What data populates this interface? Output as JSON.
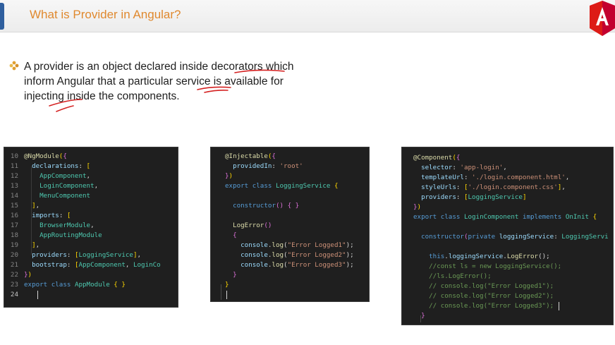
{
  "slide": {
    "title": "What is Provider in Angular?",
    "bullet": "A provider is an object declared inside decorators which\ninform Angular that a particular service is available for\ninjecting inside the components.",
    "ink_color": "#d42020",
    "accent_color": "#e0892f",
    "logo_color": "#dd1b16"
  },
  "module_code": {
    "lines": [
      {
        "no": "10",
        "text": "@NgModule({"
      },
      {
        "no": "11",
        "text": "  declarations: ["
      },
      {
        "no": "12",
        "text": "    AppComponent,"
      },
      {
        "no": "13",
        "text": "    LoginComponent,"
      },
      {
        "no": "14",
        "text": "    MenuComponent"
      },
      {
        "no": "15",
        "text": "  ],"
      },
      {
        "no": "16",
        "text": "  imports: ["
      },
      {
        "no": "17",
        "text": "    BrowserModule,"
      },
      {
        "no": "18",
        "text": "    AppRoutingModule"
      },
      {
        "no": "19",
        "text": "  ],"
      },
      {
        "no": "20",
        "text": "  providers: [LoggingService],"
      },
      {
        "no": "21",
        "text": "  bootstrap: [AppComponent, LoginCo"
      },
      {
        "no": "22",
        "text": "})"
      },
      {
        "no": "23",
        "text": "export class AppModule { }"
      },
      {
        "no": "24",
        "text": ""
      }
    ]
  },
  "service_code": {
    "lines": [
      {
        "text": "@Injectable({"
      },
      {
        "text": "  providedIn: 'root'"
      },
      {
        "text": "})"
      },
      {
        "text": "export class LoggingService {"
      },
      {
        "text": ""
      },
      {
        "text": "  constructor() { }"
      },
      {
        "text": ""
      },
      {
        "text": "  LogError()"
      },
      {
        "text": "  {"
      },
      {
        "text": "    console.log(\"Error Logged1\");"
      },
      {
        "text": "    console.log(\"Error Logged2\");"
      },
      {
        "text": "    console.log(\"Error Logged3\");"
      },
      {
        "text": "  }"
      },
      {
        "text": "}"
      }
    ]
  },
  "component_code": {
    "lines": [
      {
        "text": "@Component({"
      },
      {
        "text": "  selector: 'app-login',"
      },
      {
        "text": "  templateUrl: './login.component.html',"
      },
      {
        "text": "  styleUrls: ['./login.component.css'],"
      },
      {
        "text": "  providers: [LoggingService]"
      },
      {
        "text": "})"
      },
      {
        "text": "export class LoginComponent implements OnInit {"
      },
      {
        "text": ""
      },
      {
        "text": "  constructor(private loggingService: LoggingServi"
      },
      {
        "text": ""
      },
      {
        "text": "    this.loggingService.LogError();"
      },
      {
        "text": "    //const ls = new LoggingService();"
      },
      {
        "text": "    //ls.LogError();"
      },
      {
        "text": "    // console.log(\"Error Logged1\");"
      },
      {
        "text": "    // console.log(\"Error Logged2\");"
      },
      {
        "text": "    // console.log(\"Error Logged3\");"
      },
      {
        "text": "  }"
      }
    ]
  }
}
